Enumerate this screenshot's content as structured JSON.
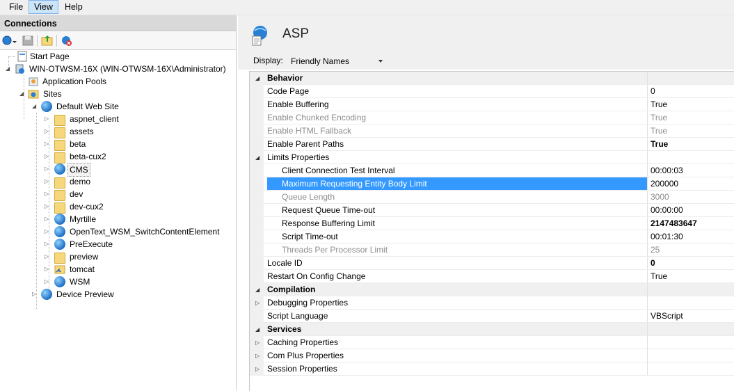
{
  "menu": [
    "File",
    "View",
    "Help"
  ],
  "connections": {
    "title": "Connections",
    "tree": [
      {
        "label": "Start Page",
        "icon": "start-page-icon",
        "level": 0
      },
      {
        "label": "WIN-OTWSM-16X (WIN-OTWSM-16X\\Administrator)",
        "icon": "server-icon",
        "level": 0
      },
      {
        "label": "Application Pools",
        "icon": "app-pools-icon",
        "level": 1
      },
      {
        "label": "Sites",
        "icon": "sites-icon",
        "level": 1
      },
      {
        "label": "Default Web Site",
        "icon": "globe-icon",
        "level": 2
      },
      {
        "label": "aspnet_client",
        "icon": "folder-icon",
        "level": 3
      },
      {
        "label": "assets",
        "icon": "folder-icon",
        "level": 3
      },
      {
        "label": "beta",
        "icon": "folder-icon",
        "level": 3
      },
      {
        "label": "beta-cux2",
        "icon": "folder-icon",
        "level": 3
      },
      {
        "label": "CMS",
        "icon": "web-app-icon",
        "level": 3
      },
      {
        "label": "demo",
        "icon": "folder-icon",
        "level": 3
      },
      {
        "label": "dev",
        "icon": "folder-icon",
        "level": 3
      },
      {
        "label": "dev-cux2",
        "icon": "folder-icon",
        "level": 3
      },
      {
        "label": "Myrtille",
        "icon": "web-app-icon",
        "level": 3
      },
      {
        "label": "OpenText_WSM_SwitchContentElement",
        "icon": "web-app-icon",
        "level": 3
      },
      {
        "label": "PreExecute",
        "icon": "web-app-icon",
        "level": 3
      },
      {
        "label": "preview",
        "icon": "folder-icon",
        "level": 3
      },
      {
        "label": "tomcat",
        "icon": "virtual-dir-icon",
        "level": 3
      },
      {
        "label": "WSM",
        "icon": "web-app-icon",
        "level": 3
      },
      {
        "label": "Device Preview",
        "icon": "globe-icon",
        "level": 2
      }
    ]
  },
  "feature": {
    "title": "ASP",
    "display_label": "Display:",
    "display_value": "Friendly Names"
  },
  "properties": [
    {
      "name": "Behavior",
      "value": "",
      "type": "category",
      "twisty": "◢"
    },
    {
      "name": "Code Page",
      "value": "0",
      "level": 1
    },
    {
      "name": "Enable Buffering",
      "value": "True",
      "level": 1
    },
    {
      "name": "Enable Chunked Encoding",
      "value": "True",
      "level": 1,
      "dim": true
    },
    {
      "name": "Enable HTML Fallback",
      "value": "True",
      "level": 1,
      "dim": true
    },
    {
      "name": "Enable Parent Paths",
      "value": "True",
      "level": 1,
      "bold": true
    },
    {
      "name": "Limits Properties",
      "value": "",
      "level": 1,
      "twisty": "◢"
    },
    {
      "name": "Client Connection Test Interval",
      "value": "00:00:03",
      "level": 2
    },
    {
      "name": "Maximum Requesting Entity Body Limit",
      "value": "200000",
      "level": 2,
      "selected": true
    },
    {
      "name": "Queue Length",
      "value": "3000",
      "level": 2,
      "dim": true
    },
    {
      "name": "Request Queue Time-out",
      "value": "00:00:00",
      "level": 2
    },
    {
      "name": "Response Buffering Limit",
      "value": "2147483647",
      "level": 2,
      "bold": true
    },
    {
      "name": "Script Time-out",
      "value": "00:01:30",
      "level": 2
    },
    {
      "name": "Threads Per Processor Limit",
      "value": "25",
      "level": 2,
      "dim": true
    },
    {
      "name": "Locale ID",
      "value": "0",
      "level": 1,
      "bold": true
    },
    {
      "name": "Restart On Config Change",
      "value": "True",
      "level": 1
    },
    {
      "name": "Compilation",
      "value": "",
      "type": "category",
      "twisty": "◢"
    },
    {
      "name": "Debugging Properties",
      "value": "",
      "level": 1,
      "twisty": "▷"
    },
    {
      "name": "Script Language",
      "value": "VBScript",
      "level": 1
    },
    {
      "name": "Services",
      "value": "",
      "type": "category",
      "twisty": "◢"
    },
    {
      "name": "Caching Properties",
      "value": "",
      "level": 1,
      "twisty": "▷"
    },
    {
      "name": "Com Plus Properties",
      "value": "",
      "level": 1,
      "twisty": "▷"
    },
    {
      "name": "Session Properties",
      "value": "",
      "level": 1,
      "twisty": "▷"
    }
  ],
  "colors": {
    "selection": "#3399ff",
    "category_bg": "#f0f0f0",
    "folder": "#f6d77c"
  }
}
